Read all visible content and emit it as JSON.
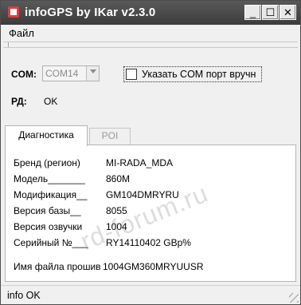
{
  "window": {
    "title": "infoGPS  by IKar v2.3.0",
    "minimize": "_",
    "maximize": "☐",
    "close": "✕"
  },
  "menu": {
    "file": "Файл"
  },
  "connection": {
    "com_label": "COM:",
    "com_value": "COM14",
    "manual_port_label": "Указать COM  порт вручн",
    "manual_port_checked": false,
    "rd_label": "РД:",
    "rd_value": "OK"
  },
  "tabs": [
    {
      "label": "Диагностика",
      "active": true
    },
    {
      "label": "POI",
      "active": false
    }
  ],
  "diagnostics": [
    {
      "label": "Бренд (регион)",
      "value": "MI-RADA_MDA"
    },
    {
      "label": "Модель_______",
      "value": "860M"
    },
    {
      "label": "Модификация__",
      "value": "GM104DMRYRU"
    },
    {
      "label": "Версия базы__",
      "value": "8055"
    },
    {
      "label": "Версия озвучки",
      "value": "1004"
    },
    {
      "label": "Серийный №___",
      "value": "RY14110402 GBp%"
    },
    {
      "label": "Имя файла прошив",
      "value": "1004GM360MRYUUSR"
    }
  ],
  "watermark": "rd-forum.ru",
  "status": {
    "text": "info OK"
  },
  "colors": {
    "titlebar": "#4a4a4a",
    "window_bg": "#f0f0f0",
    "panel_bg": "#ffffff"
  }
}
